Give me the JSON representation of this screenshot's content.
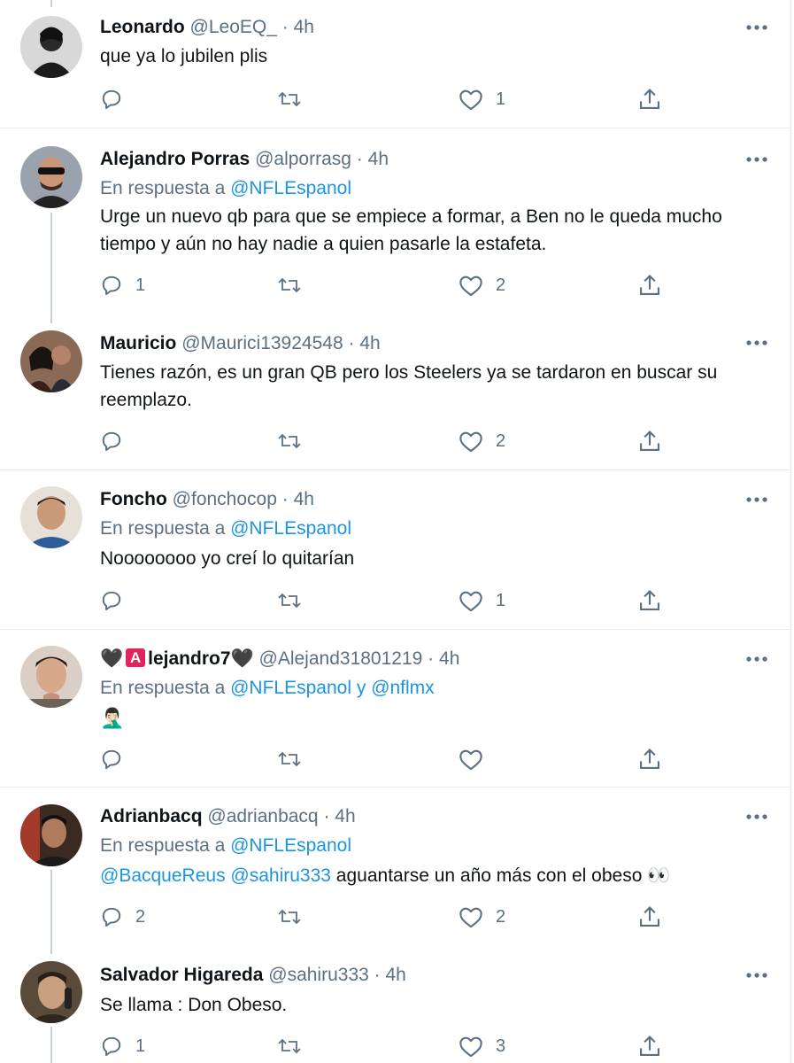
{
  "tweets": [
    {
      "name": "Leonardo",
      "handle": "@LeoEQ_",
      "time": "4h",
      "reply_prefix": "",
      "reply_to": "",
      "reply_and": "",
      "reply_to2": "",
      "mentions": "",
      "text": "que ya lo jubilen plis",
      "text_emoji": "",
      "replies": "",
      "likes": "1"
    },
    {
      "name": "Alejandro Porras",
      "handle": "@alporrasg",
      "time": "4h",
      "reply_prefix": "En respuesta a",
      "reply_to": "@NFLEspanol",
      "text": "Urge un nuevo qb para que se empiece a formar, a Ben no le queda mucho tiempo y aún no hay nadie a quien pasarle la estafeta.",
      "replies": "1",
      "likes": "2"
    },
    {
      "name": "Mauricio",
      "handle": "@Maurici13924548",
      "time": "4h",
      "text": "Tienes razón, es un gran QB pero los Steelers ya se tardaron en buscar su reemplazo.",
      "replies": "",
      "likes": "2"
    },
    {
      "name": "Foncho",
      "handle": "@fonchocop",
      "time": "4h",
      "reply_prefix": "En respuesta a",
      "reply_to": "@NFLEspanol",
      "text": "Noooooooo yo creí lo quitarían",
      "replies": "",
      "likes": "1"
    },
    {
      "name_prefix": "🖤",
      "name_badge": "A",
      "name": "lejandro7🖤",
      "handle": "@Alejand31801219",
      "time": "4h",
      "reply_prefix": "En respuesta a",
      "reply_to": "@NFLEspanol",
      "reply_and": "y",
      "reply_to2": "@nflmx",
      "text": "🤦🏻‍♂️",
      "replies": "",
      "likes": ""
    },
    {
      "name": "Adrianbacq",
      "handle": "@adrianbacq",
      "time": "4h",
      "reply_prefix": "En respuesta a",
      "reply_to": "@NFLEspanol",
      "mentions": "@BacqueReus @sahiru333",
      "text": "aguantarse un año más con el obeso",
      "text_emoji": "👀",
      "replies": "2",
      "likes": "2"
    },
    {
      "name": "Salvador Higareda",
      "handle": "@sahiru333",
      "time": "4h",
      "text": "Se llama : Don Obeso.",
      "replies": "1",
      "likes": "3"
    }
  ],
  "time_separator": "·",
  "icons": {
    "reply": "reply-icon",
    "retweet": "retweet-icon",
    "like": "heart-icon",
    "share": "share-icon",
    "more": "more-icon"
  },
  "colors": {
    "link": "#1b95e0",
    "secondary_text": "#5b7083",
    "divider": "#e6ecf0",
    "thread_line": "#c4cfd6",
    "badge_red": "#e0245e"
  }
}
